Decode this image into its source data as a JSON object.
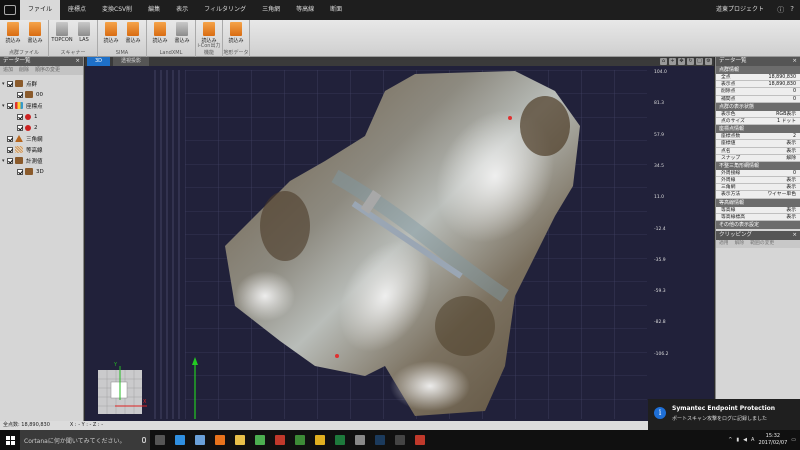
{
  "menu": {
    "items": [
      "ファイル",
      "座標点",
      "変換CSV削",
      "編集",
      "表示",
      "フィルタリング",
      "三角網",
      "等高線",
      "断面"
    ],
    "active_index": 0,
    "project_name": "道東プロジェクト",
    "controls": [
      "?"
    ]
  },
  "ribbon": {
    "groups": [
      {
        "label": "点群ファイル",
        "buttons": [
          {
            "label": "読込み",
            "icon": "txt-file-icon",
            "color": "orange"
          },
          {
            "label": "書込み",
            "icon": "txt-file-icon",
            "color": "orange"
          }
        ]
      },
      {
        "label": "スキャナー",
        "buttons": [
          {
            "label": "TOPCON",
            "icon": "scanner-icon",
            "color": "gray"
          },
          {
            "label": "LAS",
            "icon": "las-icon",
            "color": "gray"
          }
        ]
      },
      {
        "label": "SIMA",
        "buttons": [
          {
            "label": "読込み",
            "icon": "sima-file-icon",
            "color": "orange"
          },
          {
            "label": "書込み",
            "icon": "sima-file-icon",
            "color": "orange"
          }
        ]
      },
      {
        "label": "LandXML",
        "buttons": [
          {
            "label": "読込み",
            "icon": "xml-file-icon",
            "color": "orange"
          },
          {
            "label": "書込み",
            "icon": "xml-file-icon",
            "color": "gray"
          }
        ]
      },
      {
        "label": "i-Con出力機能",
        "buttons": [
          {
            "label": "読込み",
            "icon": "xml-file-icon",
            "color": "orange"
          }
        ]
      },
      {
        "label": "地形データ",
        "buttons": [
          {
            "label": "読込み",
            "icon": "xml-file-icon",
            "color": "orange"
          }
        ]
      }
    ]
  },
  "left_panel": {
    "title": "データ一覧",
    "tools": [
      "追加",
      "削除",
      "順序の変更"
    ],
    "tree": [
      {
        "label": "点群",
        "level": 0,
        "icon": "point-cloud-icon",
        "expanded": true,
        "checked": true
      },
      {
        "label": "00",
        "level": 1,
        "icon": "point-cloud-icon",
        "checked": true
      },
      {
        "label": "座標点",
        "level": 0,
        "icon": "coordinate-points-icon",
        "expanded": true,
        "checked": true
      },
      {
        "label": "1",
        "level": 1,
        "icon": "red-point-icon",
        "checked": true
      },
      {
        "label": "2",
        "level": 1,
        "icon": "red-point-icon",
        "checked": true
      },
      {
        "label": "三角網",
        "level": 0,
        "icon": "triangle-mesh-icon",
        "checked": true
      },
      {
        "label": "等高線",
        "level": 0,
        "icon": "contour-icon",
        "checked": true
      },
      {
        "label": "計測値",
        "level": 0,
        "icon": "measurement-icon",
        "expanded": true,
        "checked": true
      },
      {
        "label": "3D",
        "level": 1,
        "icon": "measurement-icon",
        "checked": true
      }
    ]
  },
  "viewport": {
    "tabs": [
      "3D",
      "透視投影"
    ],
    "active_tab": 0,
    "tools": [
      "home-icon",
      "zoom-icon",
      "pan-icon",
      "rotate-icon",
      "fit-icon",
      "settings-icon"
    ],
    "y_ticks": [
      "104.0",
      "81.3",
      "57.9",
      "34.5",
      "11.0",
      "-12.4",
      "-35.9",
      "-59.3",
      "-82.8",
      "-106.2"
    ],
    "axes": {
      "x": "X",
      "y": "Y"
    }
  },
  "right_panel": {
    "title": "データ一覧",
    "sections": [
      {
        "title": "点群情報",
        "rows": [
          {
            "k": "全点",
            "v": "18,890,830"
          },
          {
            "k": "表示点",
            "v": "18,890,830"
          },
          {
            "k": "削除点",
            "v": "0"
          },
          {
            "k": "補間点",
            "v": "0"
          }
        ]
      },
      {
        "title": "点群の表示状態",
        "rows": [
          {
            "k": "表示色",
            "v": "RGB表示"
          },
          {
            "k": "点のサイズ",
            "v": "1 ドット"
          }
        ]
      },
      {
        "title": "座標点情報",
        "rows": [
          {
            "k": "座標点数",
            "v": "2"
          },
          {
            "k": "座標値",
            "v": "表示"
          },
          {
            "k": "点名",
            "v": "表示"
          },
          {
            "k": "スナップ",
            "v": "解除"
          }
        ]
      },
      {
        "title": "不整三角形網情報",
        "rows": [
          {
            "k": "外周接線",
            "v": "0"
          },
          {
            "k": "外周線",
            "v": "表示"
          },
          {
            "k": "三角網",
            "v": "表示"
          },
          {
            "k": "表示方法",
            "v": "ワイヤー単色"
          }
        ]
      },
      {
        "title": "等高線情報",
        "rows": [
          {
            "k": "等高線",
            "v": "表示"
          },
          {
            "k": "等高線標高",
            "v": "表示"
          }
        ]
      },
      {
        "title": "その他の表示設定",
        "rows": []
      }
    ],
    "clipping": {
      "title": "クリッピング",
      "tools": [
        "適用",
        "解除",
        "範囲の変更"
      ]
    }
  },
  "status_bar": {
    "point_count": "全点数: 18,890,830",
    "coords": "X : - Y : - Z : -"
  },
  "notification": {
    "title": "Symantec Endpoint Protection",
    "body": "ポートスキャン攻撃をログに記録しました"
  },
  "taskbar": {
    "search_placeholder": "Cortanaに何か聞いてみてください。",
    "apps": [
      {
        "icon": "task-view-icon",
        "color": "#555"
      },
      {
        "icon": "edge-icon",
        "color": "#2f8fe0"
      },
      {
        "icon": "store-icon",
        "color": "#6aa0d8"
      },
      {
        "icon": "firefox-icon",
        "color": "#e8731c"
      },
      {
        "icon": "explorer-icon",
        "color": "#e8c04a"
      },
      {
        "icon": "chrome-icon",
        "color": "#4caf50"
      },
      {
        "icon": "acrobat-icon",
        "color": "#c0392b"
      },
      {
        "icon": "app-green-icon",
        "color": "#3d8b37"
      },
      {
        "icon": "app-yellow-icon",
        "color": "#e0b020"
      },
      {
        "icon": "excel-icon",
        "color": "#1e7a3c"
      },
      {
        "icon": "app-circle-icon",
        "color": "#888"
      },
      {
        "icon": "photoshop-icon",
        "color": "#1b3a5c"
      },
      {
        "icon": "app-dark-icon",
        "color": "#444"
      },
      {
        "icon": "pointcloud-app-icon",
        "color": "#c0392b"
      }
    ],
    "ime": "A",
    "time": "15:32",
    "date": "2017/02/07"
  }
}
